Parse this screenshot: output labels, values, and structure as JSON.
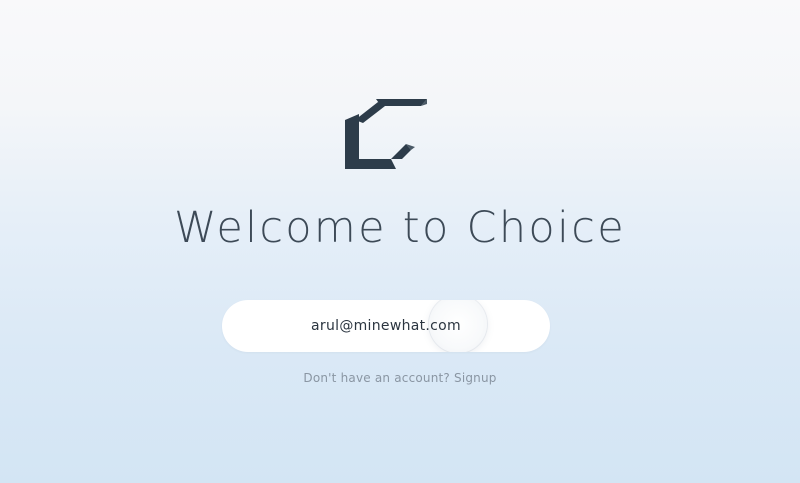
{
  "brand": {
    "logo_icon": "choice-c-logo-icon",
    "logo_color": "#2d3c4a"
  },
  "welcome": {
    "title": "Welcome to Choice"
  },
  "login": {
    "email_value": "arul@minewhat.com"
  },
  "signup": {
    "prompt": "Don't have an account?",
    "link_label": "Signup"
  },
  "colors": {
    "title": "#3d4a57",
    "muted_text": "#8a96a3",
    "background_top": "#f9f9fa",
    "background_bottom": "#d3e5f4"
  }
}
